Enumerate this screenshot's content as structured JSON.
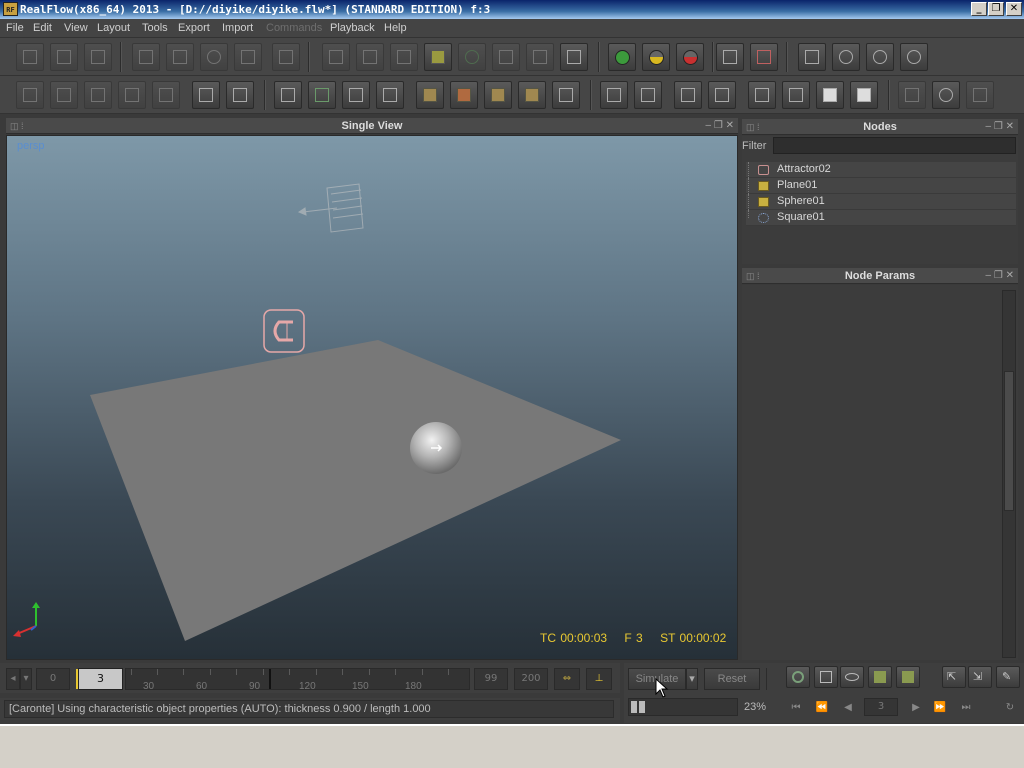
{
  "window": {
    "app_icon": "RF",
    "title": "RealFlow(x86_64) 2013 - [D://diyike/diyike.flw*] (STANDARD EDITION) f:3",
    "minimize_label": "_",
    "maximize_label": "❐",
    "close_label": "✕"
  },
  "menu": {
    "items": [
      {
        "label": "File",
        "enabled": true
      },
      {
        "label": "Edit",
        "enabled": true
      },
      {
        "label": "View",
        "enabled": true
      },
      {
        "label": "Layout",
        "enabled": true
      },
      {
        "label": "Tools",
        "enabled": true
      },
      {
        "label": "Export",
        "enabled": true
      },
      {
        "label": "Import",
        "enabled": true
      },
      {
        "label": "Commands",
        "enabled": false
      },
      {
        "label": "Playback",
        "enabled": true
      },
      {
        "label": "Help",
        "enabled": true
      }
    ]
  },
  "viewport": {
    "panel_title": "Single View",
    "camera_label": "persp",
    "hud_tc": "TC 00:00:03",
    "hud_frame": "F 3",
    "hud_st": "ST 00:00:02"
  },
  "nodes_panel": {
    "title": "Nodes",
    "filter_label": "Filter",
    "filter_value": "",
    "nodes": [
      {
        "name": "Attractor02",
        "icon": "attractor-icon"
      },
      {
        "name": "Plane01",
        "icon": "cube-object-icon"
      },
      {
        "name": "Sphere01",
        "icon": "cube-object-icon"
      },
      {
        "name": "Square01",
        "icon": "emitter-icon"
      }
    ]
  },
  "params_panel": {
    "title": "Node Params"
  },
  "timeline": {
    "start_frame": "0",
    "current_frame": "3",
    "ticks": [
      "30",
      "60",
      "90",
      "120",
      "150",
      "180"
    ],
    "end_frame": "99",
    "max_frame": "200"
  },
  "simulation": {
    "simulate_label": "Simulate",
    "reset_label": "Reset",
    "progress": "23%",
    "frame_box": "3"
  },
  "status": {
    "message": "[Caronte] Using characteristic object properties (AUTO): thickness 0.900 / length 1.000"
  },
  "colors": {
    "hud": "#e8c832",
    "camera_label": "#5a8ed0",
    "sim_green": "#3c9a3c",
    "sim_yellow": "#d8b820",
    "sim_red": "#c83030"
  }
}
